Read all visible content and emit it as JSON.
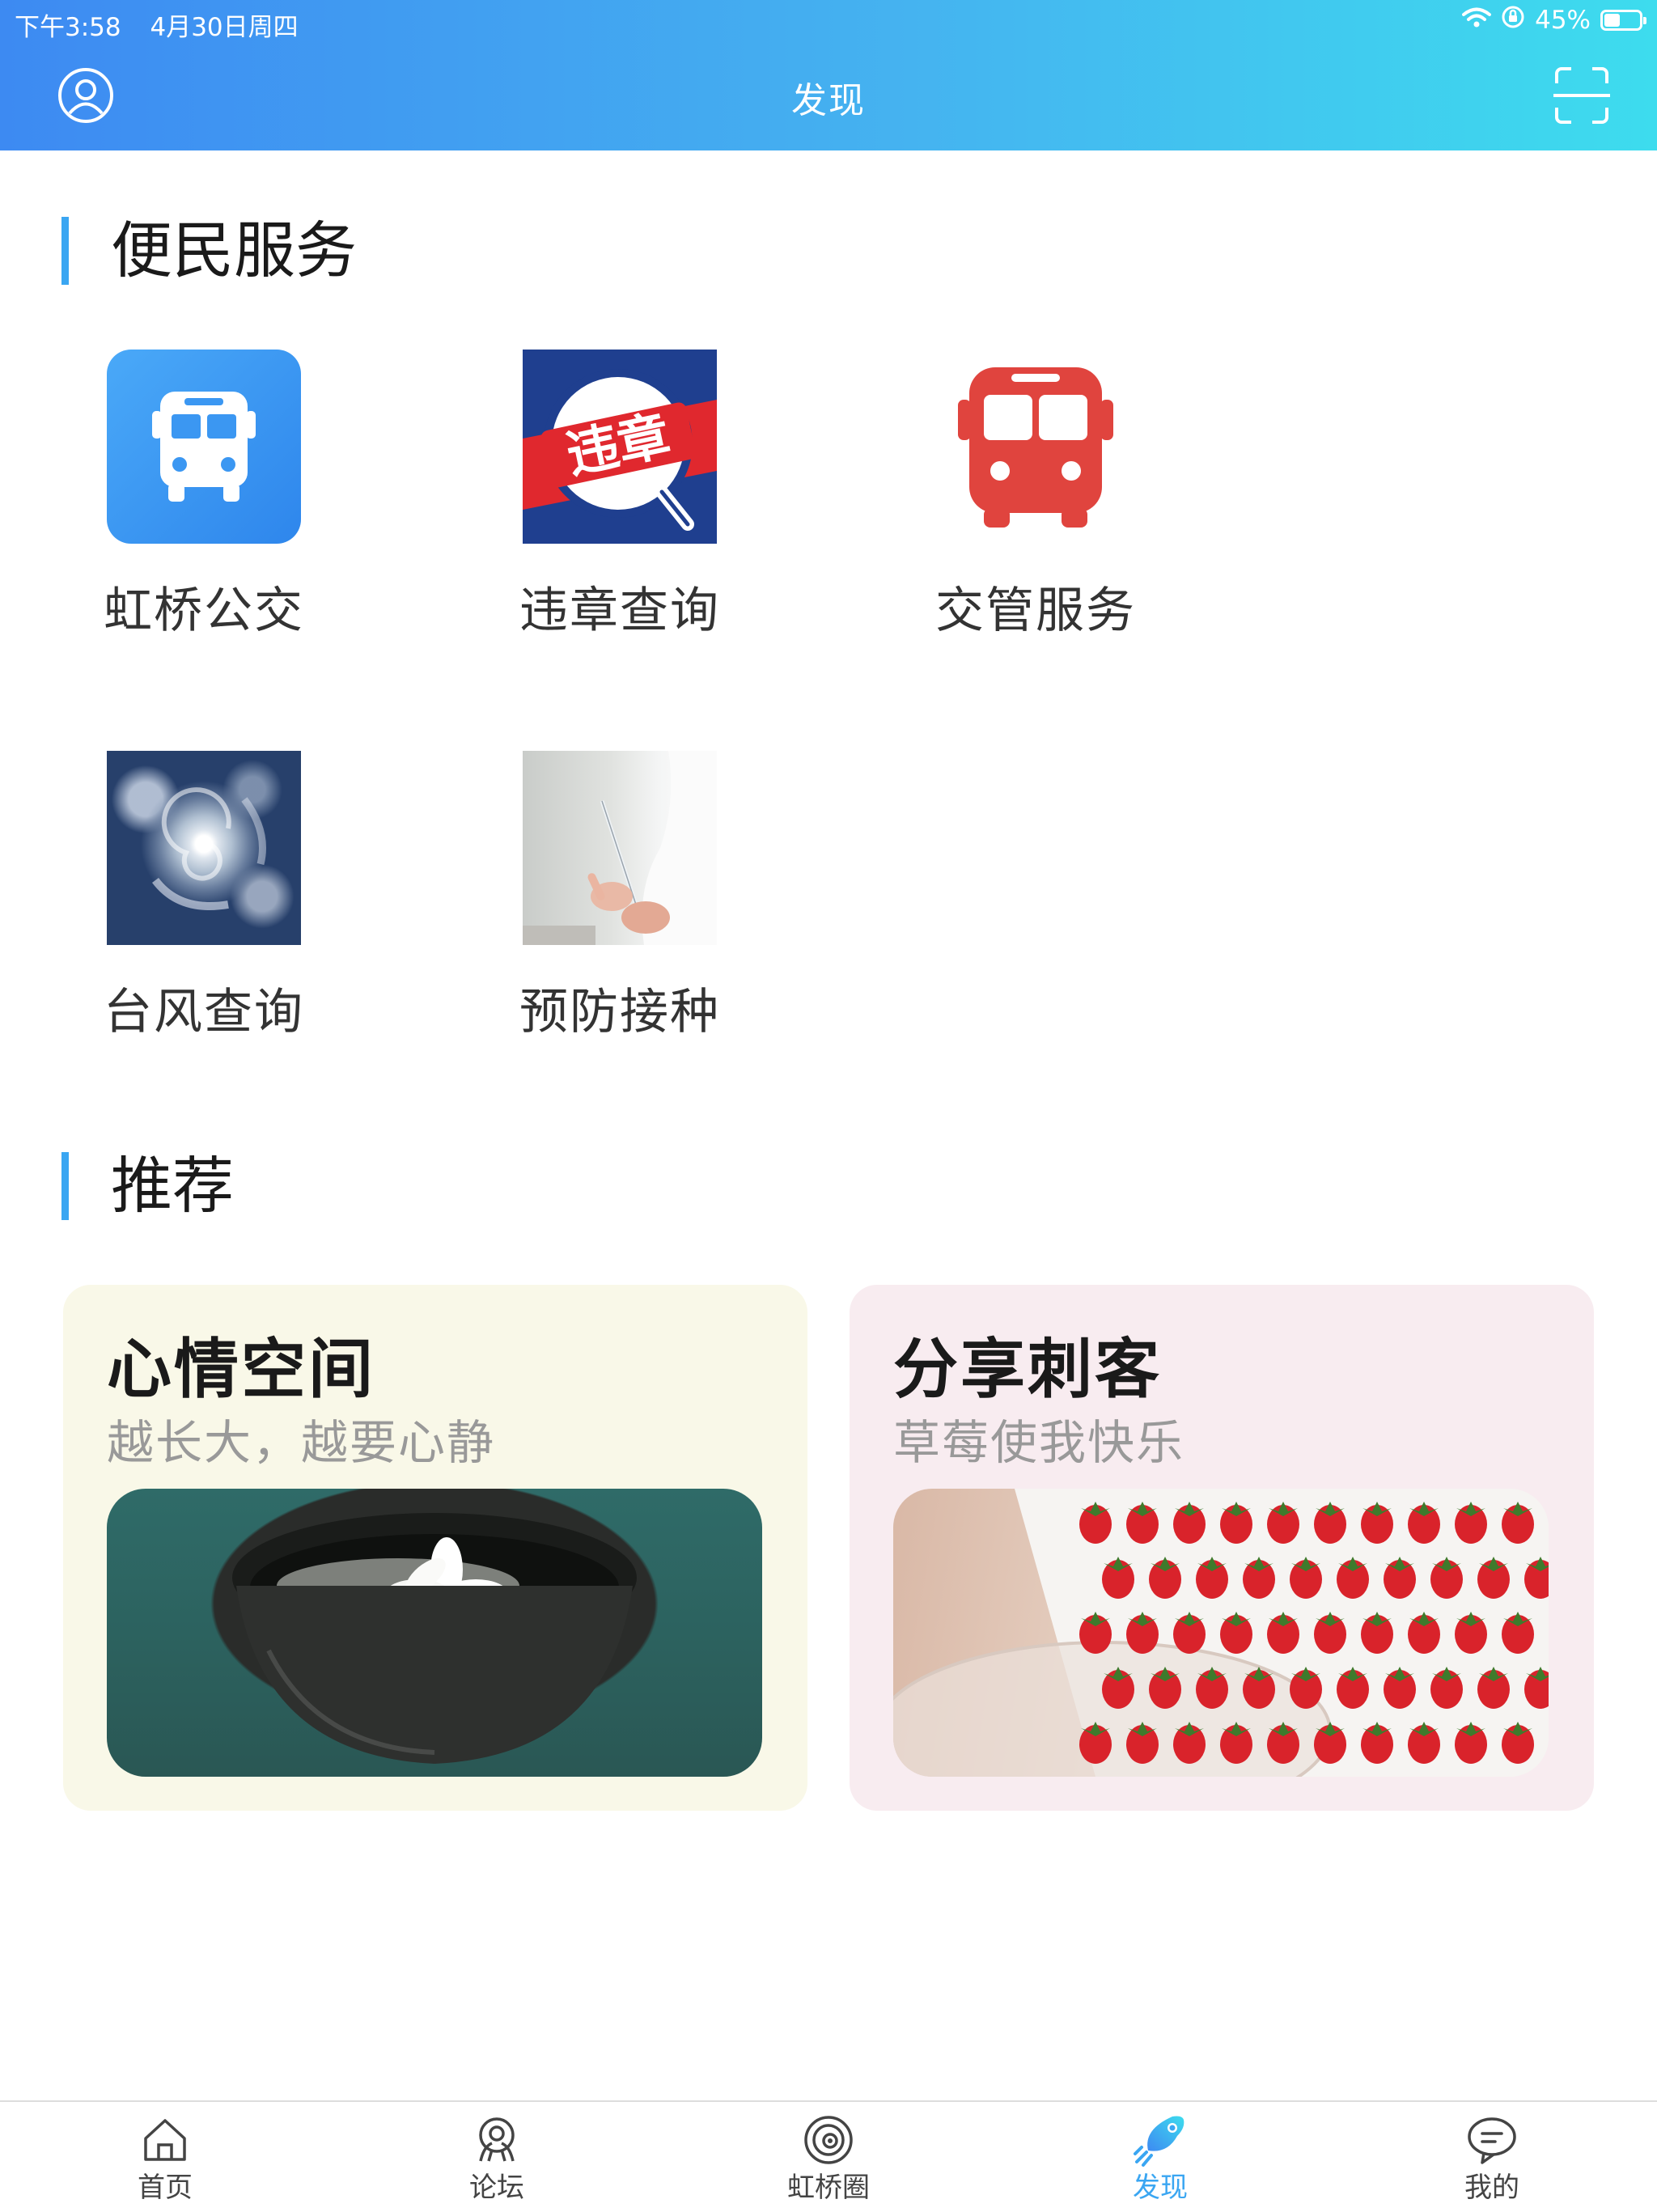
{
  "status_bar": {
    "time": "下午3:58",
    "date": "4月30日周四",
    "battery": "45%",
    "battery_level": 0.45
  },
  "header": {
    "title": "发现",
    "profile_icon": "user-circle-icon",
    "scan_icon": "scan-icon"
  },
  "colors": {
    "header_gradient_start": "#3d8af2",
    "header_gradient_end": "#3ddcee",
    "accent": "#3aa6f2"
  },
  "services": {
    "title": "便民服务",
    "items": [
      {
        "label": "虹桥公交",
        "icon": "bus-icon"
      },
      {
        "label": "违章查询",
        "icon": "violation-icon",
        "icon_text": "违章"
      },
      {
        "label": "交管服务",
        "icon": "red-bus-icon"
      },
      {
        "label": "台风查询",
        "icon": "typhoon-satellite-image"
      },
      {
        "label": "预防接种",
        "icon": "vaccine-syringe-image"
      }
    ]
  },
  "recommend": {
    "title": "推荐",
    "cards": [
      {
        "title": "心情空间",
        "subtitle": "越长大，越要心静",
        "image": "tea-bowl-flower-photo"
      },
      {
        "title": "分享刺客",
        "subtitle": "草莓使我快乐",
        "image": "strawberries-photo"
      }
    ]
  },
  "tabbar": {
    "items": [
      {
        "label": "首页",
        "icon": "home-icon",
        "active": false
      },
      {
        "label": "论坛",
        "icon": "forum-icon",
        "active": false
      },
      {
        "label": "虹桥圈",
        "icon": "circle-icon",
        "active": false
      },
      {
        "label": "发现",
        "icon": "rocket-icon",
        "active": true
      },
      {
        "label": "我的",
        "icon": "chat-bubble-icon",
        "active": false
      }
    ]
  }
}
